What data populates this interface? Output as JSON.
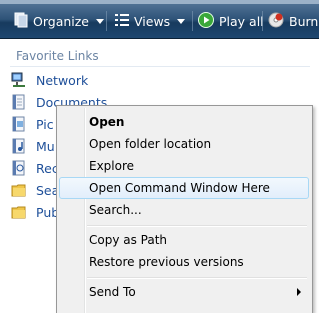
{
  "toolbar": {
    "organize": "Organize",
    "views": "Views",
    "play_all": "Play all",
    "burn": "Burn"
  },
  "favorites": {
    "title": "Favorite Links",
    "items": [
      {
        "label": "Network",
        "icon": "network-icon"
      },
      {
        "label": "Documents",
        "icon": "documents-icon"
      },
      {
        "label": "Pic",
        "icon": "pictures-icon"
      },
      {
        "label": "Mu",
        "icon": "music-icon"
      },
      {
        "label": "Rec",
        "icon": "recent-icon"
      },
      {
        "label": "Sea",
        "icon": "searches-folder-icon"
      },
      {
        "label": "Pub",
        "icon": "public-folder-icon"
      }
    ]
  },
  "context_menu": {
    "open": "Open",
    "open_folder_location": "Open folder location",
    "explore": "Explore",
    "open_command_window": "Open Command Window Here",
    "search": "Search...",
    "copy_as_path": "Copy as Path",
    "restore_previous_versions": "Restore previous versions",
    "send_to": "Send To"
  },
  "colors": {
    "toolbar": "#1e4770",
    "link": "#1e4f99",
    "highlight_border": "#a8d8f5"
  }
}
